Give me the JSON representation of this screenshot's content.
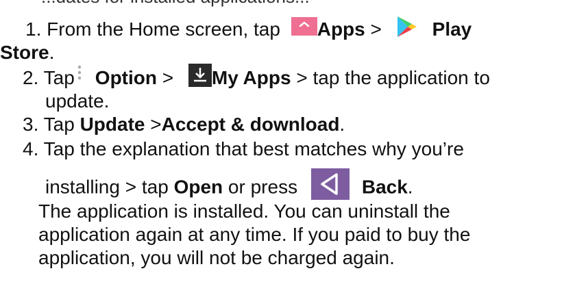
{
  "intro_partial": "...dates for installed applications...",
  "steps": [
    {
      "num": "1.",
      "pre": "From the Home screen, tap ",
      "apps_label": "Apps",
      "sep": " > ",
      "play_label": "Play",
      "store_label": "Store",
      "end": "."
    },
    {
      "num": "2.",
      "pre": "Tap",
      "option_label": "Option",
      "sep": " > ",
      "myapps_label": "My Apps",
      "post": " > tap the application to",
      "cont": "update."
    },
    {
      "num": "3.",
      "pre": "Tap ",
      "update_label": "Update",
      "sep": " >",
      "accept_label": "Accept & download",
      "end": "."
    },
    {
      "num": "4.",
      "line1": "Tap the explanation that best matches why you’re",
      "pre": "installing > tap ",
      "open_label": "Open",
      "mid": " or press",
      "back_label": "Back",
      "end": "."
    }
  ],
  "note": [
    "The application is installed. You can uninstall the",
    "application again at any time. If you paid to buy the",
    "application, you will not be charged again."
  ],
  "colors": {
    "apps_icon": "#ef6f92",
    "back_icon": "#7d5da0",
    "download_icon": "#2a2a2a",
    "text": "#111111"
  },
  "icons": [
    "apps-icon",
    "play-store-icon",
    "option-dots-icon",
    "download-icon",
    "back-icon"
  ]
}
